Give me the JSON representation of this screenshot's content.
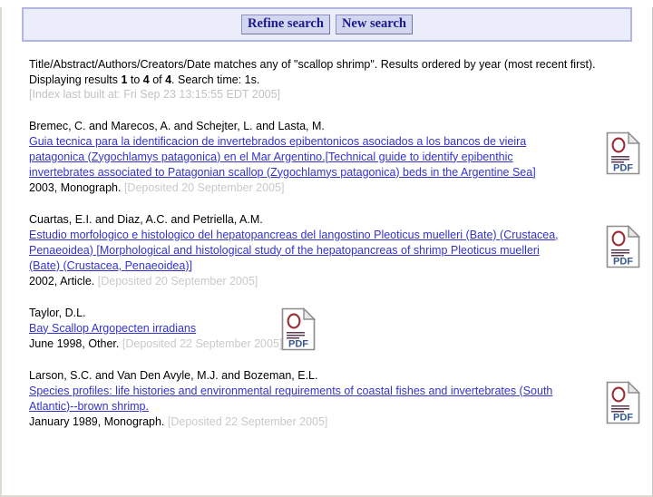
{
  "toolbar": {
    "refine_label": "Refine search",
    "new_label": "New search"
  },
  "summary": {
    "line1": "Title/Abstract/Authors/Creators/Date matches any of \"scallop shrimp\". Results ordered by year (most recent first).",
    "displaying_prefix": "Displaying results ",
    "from": "1",
    "to_word": " to ",
    "to": "4",
    "of_word": " of ",
    "total": "4",
    "search_time": ". Search time: 1s.",
    "index_built": "[Index last built at: Fri Sep 23 13:15:55 EDT 2005]"
  },
  "icons": {
    "pdf": "pdf-document-icon",
    "pdf_label": "PDF"
  },
  "results": [
    {
      "authors": "Bremec, C. and Marecos, A. and Schejter, L. and Lasta, M.",
      "title": "Guia tecnica para la identificacion de invertebrados epibentonicos asociados a los bancos de vieira patagonica (Zygochlamys patagonica) en el Mar Argentino.[Technical guide to identify epibenthic invertebrates associated to Patagonian scallop (Zygochlamys patagonica) beds in the Argentine Sea]",
      "meta": "2003, Monograph.",
      "deposited": "[Deposited 20 September 2005]",
      "has_pdf": true,
      "pdf_position": "side"
    },
    {
      "authors": "Cuartas, E.I. and Diaz, A.C. and Petriella, A.M.",
      "title": "Estudio morfologico e histologico del hepatopancreas del langostino Pleoticus muelleri (Bate) (Crustacea, Penaeoidea) [Morphological and histological study of the hepatopancreas of shrimp Pleoticus muelleri (Bate) (Crustacea, Penaeoidea)]",
      "meta": "2002, Article.",
      "deposited": "[Deposited 20 September 2005]",
      "has_pdf": true,
      "pdf_position": "side"
    },
    {
      "authors": "Taylor, D.L.",
      "title": "Bay Scallop Argopecten irradians",
      "meta": "June 1998, Other.",
      "deposited": "[Deposited 22 September 2005]",
      "has_pdf": true,
      "pdf_position": "inline"
    },
    {
      "authors": "Larson, S.C. and Van Den Avyle, M.J. and Bozeman, E.L.",
      "title": "Species profiles: life histories and environmental requirements of coastal fishes and invertebrates (South Atlantic)--brown shrimp.",
      "meta": "January 1989, Monograph.",
      "deposited": "[Deposited 22 September 2005]",
      "has_pdf": true,
      "pdf_position": "side"
    }
  ],
  "colors": {
    "link": "#3333cc",
    "toolbar_bg": "#ecedfa",
    "toolbar_border": "#b3b6e0",
    "button_bg": "#d3d6ef",
    "button_text": "#1a1a8c",
    "muted_text": "#c9c9c9"
  }
}
